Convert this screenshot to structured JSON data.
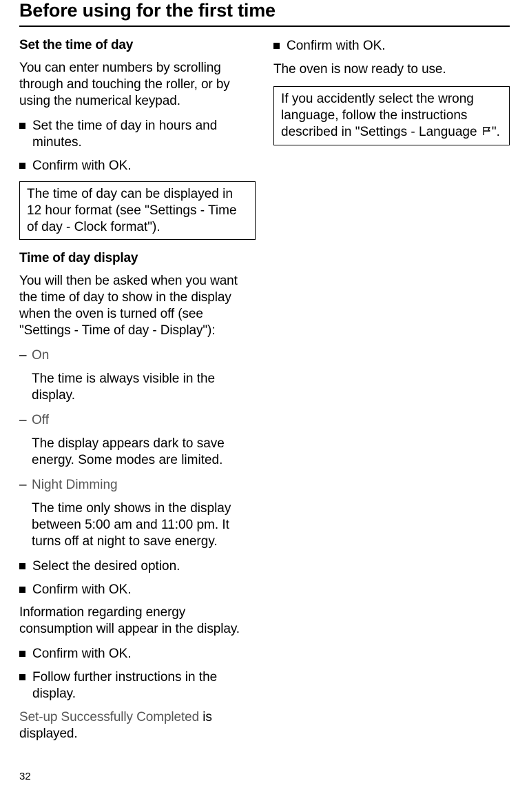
{
  "page_title": "Before using for the first time",
  "page_number": "32",
  "left": {
    "set_time_heading": "Set the time of day",
    "set_time_intro": "You can enter numbers by scrolling through and touching the roller, or by using the numerical keypad.",
    "set_time_step1": "Set the time of day in hours and minutes.",
    "set_time_step2": "Confirm with OK.",
    "clock_format_box": "The time of day can be displayed in 12 hour format (see \"Settings - Time of day - Clock format\").",
    "tod_display_heading": "Time of day display",
    "tod_display_intro": "You will then be asked when you want the time of day to show in the display when the oven is turned off (see \"Settings - Time of day - Display\"):",
    "option_on": "On",
    "option_on_desc": "The time is always visible in the display.",
    "option_off": "Off",
    "option_off_desc": "The display appears dark to save energy. Some modes are limited.",
    "option_night": "Night Dimming",
    "option_night_desc": "The time only shows in the display between 5:00 am and 11:00 pm. It turns off at night to save energy.",
    "select_option": "Select the desired option.",
    "confirm_ok_2": "Confirm with OK.",
    "energy_info": "Information regarding energy consumption will appear in the display.",
    "confirm_ok_3": "Confirm with OK.",
    "follow_instructions": "Follow further instructions in the display.",
    "setup_complete_display": "Set-up Successfully Completed",
    "setup_complete_suffix": " is displayed."
  },
  "right": {
    "confirm_ok": "Confirm with OK.",
    "ready": "The oven is now ready to use.",
    "language_box_pre": "If you accidently select the wrong language, follow the instructions described in \"Settings - Language ",
    "language_box_post": "\"."
  }
}
